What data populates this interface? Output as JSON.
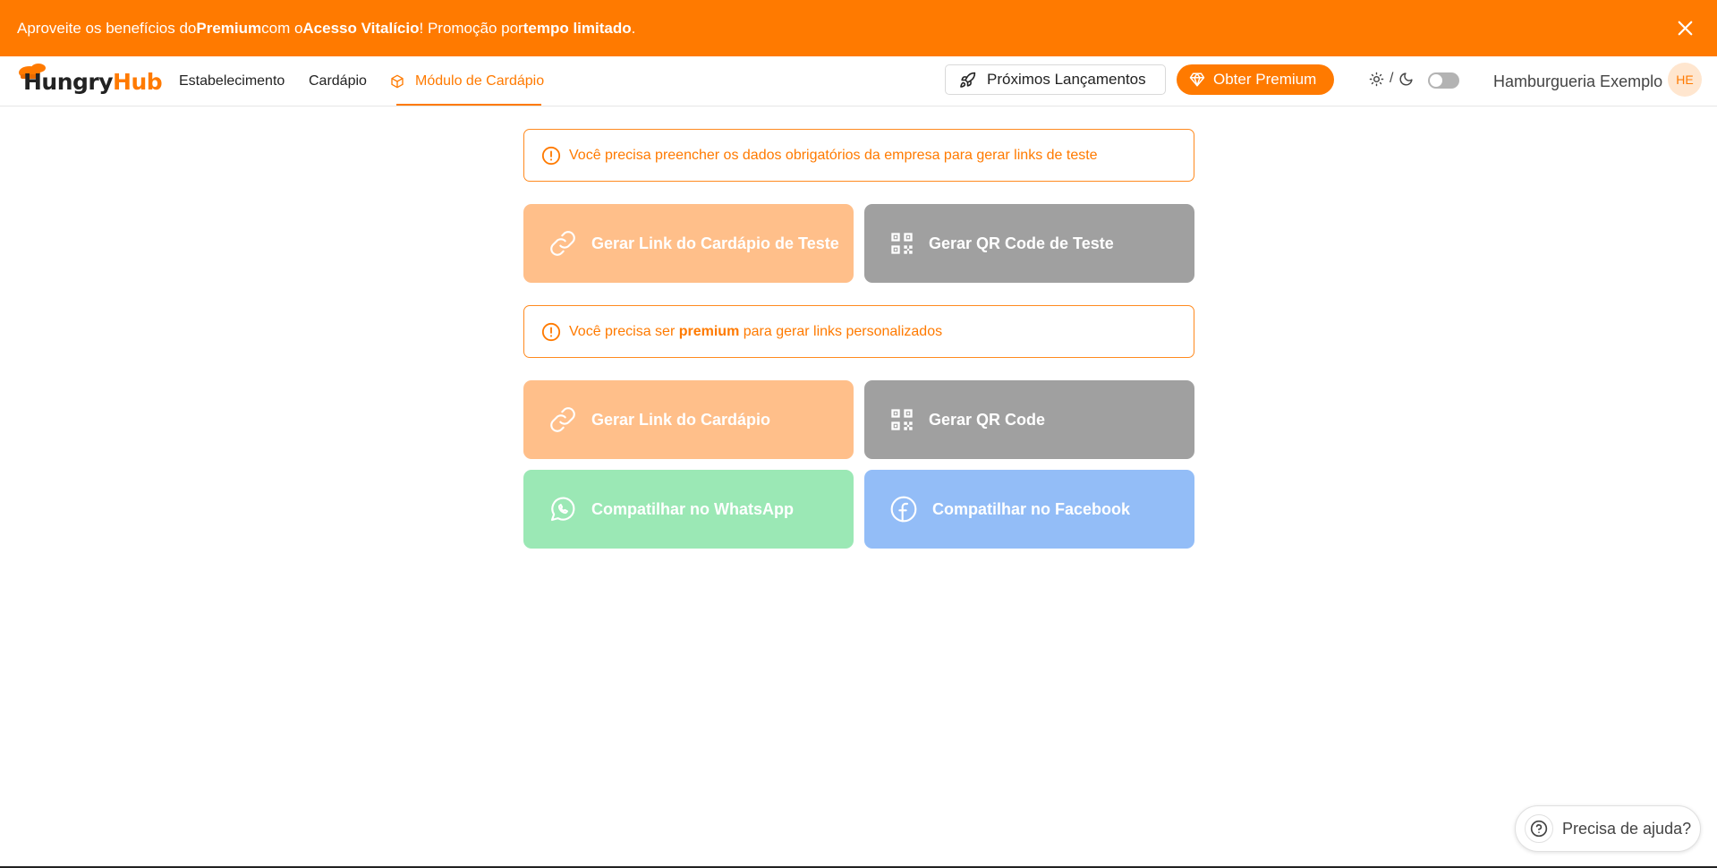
{
  "promo": {
    "prefix": "Aproveite os benefícios do ",
    "premium": "Premium",
    "middle": " com o ",
    "lifetime": "Acesso Vitalício",
    "mid2": "! Promoção por ",
    "limited": "tempo limitado",
    "suffix": "."
  },
  "brand": {
    "part1": "Hungry",
    "part2": "Hub"
  },
  "nav": {
    "establishment": "Estabelecimento",
    "menu": "Cardápio",
    "menu_module": "Módulo de Cardápio"
  },
  "header": {
    "launches_label": "Próximos Lançamentos",
    "premium_label": "Obter Premium",
    "theme_separator": "/",
    "user_name": "Hamburgueria Exemplo",
    "avatar_initials": "HE"
  },
  "alerts": {
    "test": "Você precisa preencher os dados obrigatórios da empresa para gerar links de teste",
    "premium_prefix": "Você precisa ser ",
    "premium_word": "premium",
    "premium_suffix": " para gerar links personalizados"
  },
  "tiles": {
    "test_link": "Gerar Link do Cardápio de Teste",
    "test_qr": "Gerar QR Code de Teste",
    "link": "Gerar Link do Cardápio",
    "qr": "Gerar QR Code",
    "whatsapp": "Compatilhar no WhatsApp",
    "facebook": "Compatilhar no Facebook"
  },
  "help": {
    "label": "Precisa de ajuda?"
  },
  "colors": {
    "accent": "#ff7a00",
    "orange_tile": "#ffbf8a",
    "gray_tile": "#a0a0a0",
    "green_tile": "#9be8b5",
    "blue_tile": "#93bdf7"
  },
  "icons": [
    "close-icon",
    "rocket-icon",
    "diamond-icon",
    "sun-icon",
    "moon-icon",
    "alert-circle-icon",
    "link-icon",
    "qr-code-icon",
    "whatsapp-icon",
    "facebook-icon",
    "question-icon"
  ]
}
